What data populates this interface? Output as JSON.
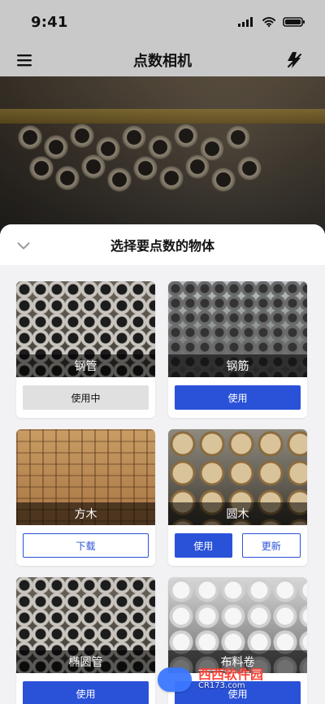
{
  "status_bar": {
    "time": "9:41"
  },
  "navbar": {
    "title": "点数相机"
  },
  "sheet": {
    "title": "选择要点数的物体"
  },
  "items": [
    {
      "label": "钢管",
      "buttons": [
        {
          "label": "使用中"
        }
      ]
    },
    {
      "label": "钢筋",
      "buttons": [
        {
          "label": "使用"
        }
      ]
    },
    {
      "label": "方木",
      "buttons": [
        {
          "label": "下载"
        }
      ]
    },
    {
      "label": "圆木",
      "buttons": [
        {
          "label": "使用"
        },
        {
          "label": "更新"
        }
      ]
    },
    {
      "label": "椭圆管",
      "buttons": [
        {
          "label": "使用"
        }
      ]
    },
    {
      "label": "布料卷",
      "buttons": [
        {
          "label": "使用"
        }
      ]
    }
  ],
  "watermark": {
    "line1": "西西软件园",
    "line2": "CR173.com"
  },
  "colors": {
    "primary": "#2a52d8",
    "in_use_gray": "#e0e0e0",
    "overlay_dark": "#000000"
  },
  "icons": {
    "menu": "menu-icon",
    "flash_off": "flash-off-icon",
    "chevron": "chevron-down-icon",
    "signal": "signal-icon",
    "wifi": "wifi-icon",
    "battery": "battery-icon"
  }
}
